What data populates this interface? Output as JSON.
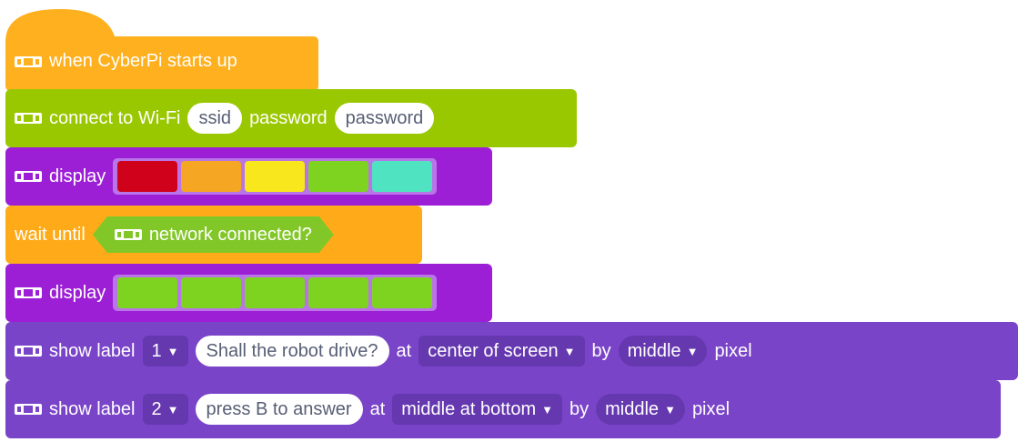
{
  "colors": {
    "events": "#ffb01e",
    "wifi": "#9ac800",
    "lights": "#9c1fd6",
    "control": "#ffab19",
    "display": "#7a44c8",
    "dropdown_bg": "#6538b0",
    "hex_bg": "#82c728"
  },
  "blocks": {
    "start": {
      "label": "when CyberPi starts up",
      "icon": "cyberpi-icon"
    },
    "wifi": {
      "label": "connect to Wi-Fi",
      "ssid": "ssid",
      "password_label": "password",
      "password_value": "password",
      "icon": "cyberpi-icon"
    },
    "display1": {
      "label": "display",
      "icon": "cyberpi-icon",
      "leds": [
        "#d0021b",
        "#f5a623",
        "#f8e71c",
        "#7ed321",
        "#50e3c2"
      ]
    },
    "wait": {
      "label": "wait until",
      "condition": "network connected?",
      "icon": "cyberpi-icon"
    },
    "display2": {
      "label": "display",
      "icon": "cyberpi-icon",
      "leds": [
        "#7ed321",
        "#7ed321",
        "#7ed321",
        "#7ed321",
        "#7ed321"
      ]
    },
    "label1": {
      "label": "show label",
      "index": "1",
      "text": "Shall the robot drive?",
      "at": "at",
      "position": "center of screen",
      "by": "by",
      "size": "middle",
      "unit": "pixel",
      "icon": "cyberpi-icon"
    },
    "label2": {
      "label": "show label",
      "index": "2",
      "text": "press B to answer",
      "at": "at",
      "position": "middle at bottom",
      "by": "by",
      "size": "middle",
      "unit": "pixel",
      "icon": "cyberpi-icon"
    }
  }
}
